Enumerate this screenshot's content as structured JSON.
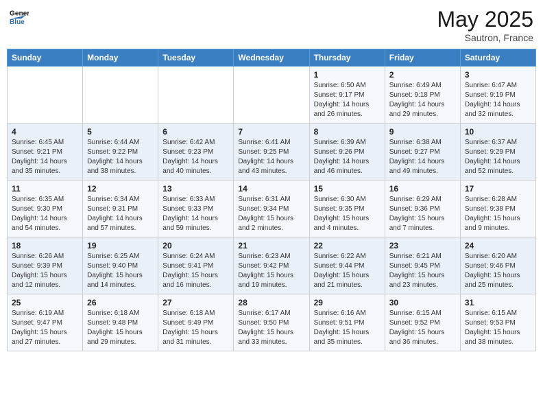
{
  "header": {
    "logo_line1": "General",
    "logo_line2": "Blue",
    "month": "May 2025",
    "location": "Sautron, France"
  },
  "weekdays": [
    "Sunday",
    "Monday",
    "Tuesday",
    "Wednesday",
    "Thursday",
    "Friday",
    "Saturday"
  ],
  "weeks": [
    [
      {
        "day": "",
        "content": ""
      },
      {
        "day": "",
        "content": ""
      },
      {
        "day": "",
        "content": ""
      },
      {
        "day": "",
        "content": ""
      },
      {
        "day": "1",
        "content": "Sunrise: 6:50 AM\nSunset: 9:17 PM\nDaylight: 14 hours\nand 26 minutes."
      },
      {
        "day": "2",
        "content": "Sunrise: 6:49 AM\nSunset: 9:18 PM\nDaylight: 14 hours\nand 29 minutes."
      },
      {
        "day": "3",
        "content": "Sunrise: 6:47 AM\nSunset: 9:19 PM\nDaylight: 14 hours\nand 32 minutes."
      }
    ],
    [
      {
        "day": "4",
        "content": "Sunrise: 6:45 AM\nSunset: 9:21 PM\nDaylight: 14 hours\nand 35 minutes."
      },
      {
        "day": "5",
        "content": "Sunrise: 6:44 AM\nSunset: 9:22 PM\nDaylight: 14 hours\nand 38 minutes."
      },
      {
        "day": "6",
        "content": "Sunrise: 6:42 AM\nSunset: 9:23 PM\nDaylight: 14 hours\nand 40 minutes."
      },
      {
        "day": "7",
        "content": "Sunrise: 6:41 AM\nSunset: 9:25 PM\nDaylight: 14 hours\nand 43 minutes."
      },
      {
        "day": "8",
        "content": "Sunrise: 6:39 AM\nSunset: 9:26 PM\nDaylight: 14 hours\nand 46 minutes."
      },
      {
        "day": "9",
        "content": "Sunrise: 6:38 AM\nSunset: 9:27 PM\nDaylight: 14 hours\nand 49 minutes."
      },
      {
        "day": "10",
        "content": "Sunrise: 6:37 AM\nSunset: 9:29 PM\nDaylight: 14 hours\nand 52 minutes."
      }
    ],
    [
      {
        "day": "11",
        "content": "Sunrise: 6:35 AM\nSunset: 9:30 PM\nDaylight: 14 hours\nand 54 minutes."
      },
      {
        "day": "12",
        "content": "Sunrise: 6:34 AM\nSunset: 9:31 PM\nDaylight: 14 hours\nand 57 minutes."
      },
      {
        "day": "13",
        "content": "Sunrise: 6:33 AM\nSunset: 9:33 PM\nDaylight: 14 hours\nand 59 minutes."
      },
      {
        "day": "14",
        "content": "Sunrise: 6:31 AM\nSunset: 9:34 PM\nDaylight: 15 hours\nand 2 minutes."
      },
      {
        "day": "15",
        "content": "Sunrise: 6:30 AM\nSunset: 9:35 PM\nDaylight: 15 hours\nand 4 minutes."
      },
      {
        "day": "16",
        "content": "Sunrise: 6:29 AM\nSunset: 9:36 PM\nDaylight: 15 hours\nand 7 minutes."
      },
      {
        "day": "17",
        "content": "Sunrise: 6:28 AM\nSunset: 9:38 PM\nDaylight: 15 hours\nand 9 minutes."
      }
    ],
    [
      {
        "day": "18",
        "content": "Sunrise: 6:26 AM\nSunset: 9:39 PM\nDaylight: 15 hours\nand 12 minutes."
      },
      {
        "day": "19",
        "content": "Sunrise: 6:25 AM\nSunset: 9:40 PM\nDaylight: 15 hours\nand 14 minutes."
      },
      {
        "day": "20",
        "content": "Sunrise: 6:24 AM\nSunset: 9:41 PM\nDaylight: 15 hours\nand 16 minutes."
      },
      {
        "day": "21",
        "content": "Sunrise: 6:23 AM\nSunset: 9:42 PM\nDaylight: 15 hours\nand 19 minutes."
      },
      {
        "day": "22",
        "content": "Sunrise: 6:22 AM\nSunset: 9:44 PM\nDaylight: 15 hours\nand 21 minutes."
      },
      {
        "day": "23",
        "content": "Sunrise: 6:21 AM\nSunset: 9:45 PM\nDaylight: 15 hours\nand 23 minutes."
      },
      {
        "day": "24",
        "content": "Sunrise: 6:20 AM\nSunset: 9:46 PM\nDaylight: 15 hours\nand 25 minutes."
      }
    ],
    [
      {
        "day": "25",
        "content": "Sunrise: 6:19 AM\nSunset: 9:47 PM\nDaylight: 15 hours\nand 27 minutes."
      },
      {
        "day": "26",
        "content": "Sunrise: 6:18 AM\nSunset: 9:48 PM\nDaylight: 15 hours\nand 29 minutes."
      },
      {
        "day": "27",
        "content": "Sunrise: 6:18 AM\nSunset: 9:49 PM\nDaylight: 15 hours\nand 31 minutes."
      },
      {
        "day": "28",
        "content": "Sunrise: 6:17 AM\nSunset: 9:50 PM\nDaylight: 15 hours\nand 33 minutes."
      },
      {
        "day": "29",
        "content": "Sunrise: 6:16 AM\nSunset: 9:51 PM\nDaylight: 15 hours\nand 35 minutes."
      },
      {
        "day": "30",
        "content": "Sunrise: 6:15 AM\nSunset: 9:52 PM\nDaylight: 15 hours\nand 36 minutes."
      },
      {
        "day": "31",
        "content": "Sunrise: 6:15 AM\nSunset: 9:53 PM\nDaylight: 15 hours\nand 38 minutes."
      }
    ]
  ]
}
